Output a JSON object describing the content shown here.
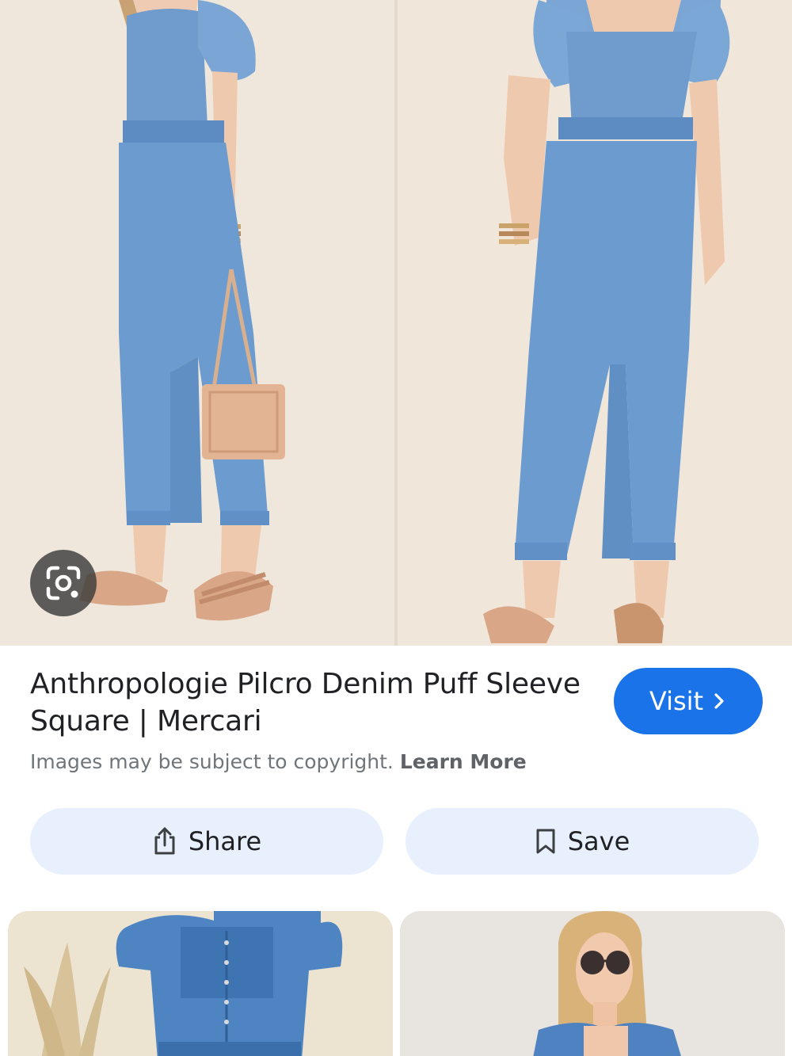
{
  "result": {
    "title": "Anthropologie Pilcro Denim Puff Sleeve Square | Mercari",
    "visit_label": "Visit",
    "copyright_text": "Images may be subject to copyright.",
    "learn_more_label": "Learn More"
  },
  "actions": {
    "share_label": "Share",
    "save_label": "Save"
  },
  "icons": {
    "lens": "google-lens-icon",
    "visit": "chevron-right-icon",
    "share": "share-icon",
    "save": "bookmark-icon"
  },
  "colors": {
    "accent": "#1a73e8",
    "action_bg": "#e8f0fe",
    "title_text": "#202124",
    "muted_text": "#70757a"
  }
}
